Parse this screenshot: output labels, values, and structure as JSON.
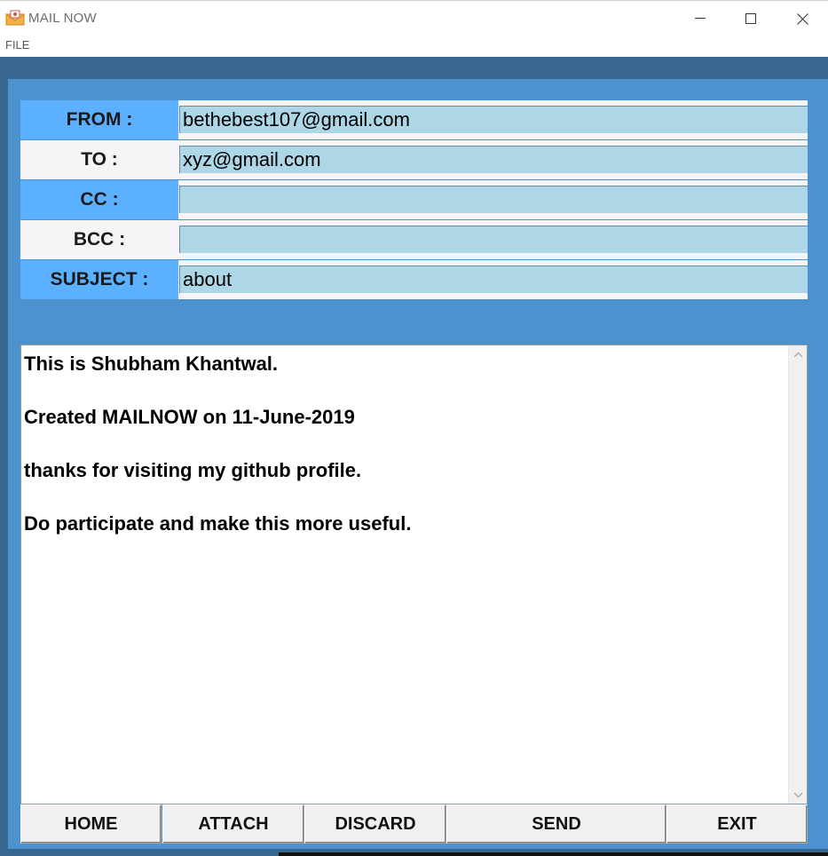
{
  "window": {
    "title": "MAIL NOW",
    "minimize_glyph": "—",
    "maximize_glyph": "☐",
    "close_glyph": "✕"
  },
  "menu": {
    "file_label": "FILE"
  },
  "fields": {
    "from": {
      "label": "FROM :",
      "value": "bethebest107@gmail.com"
    },
    "to": {
      "label": "TO :",
      "value": "xyz@gmail.com"
    },
    "cc": {
      "label": "CC :",
      "value": ""
    },
    "bcc": {
      "label": "BCC :",
      "value": ""
    },
    "subject": {
      "label": "SUBJECT :",
      "value": "about"
    }
  },
  "body": {
    "lines": [
      "This is Shubham Khantwal.",
      "Created MAILNOW on 11-June-2019",
      "thanks for visiting my github profile.",
      "Do participate and make this more useful."
    ]
  },
  "buttons": {
    "home": "HOME",
    "attach": "ATTACH",
    "discard": "DISCARD",
    "send": "SEND",
    "exit": "EXIT"
  },
  "icons": {
    "app": "mail-envelope-icon",
    "scroll_up": "chevron-up-icon",
    "scroll_down": "chevron-down-icon"
  },
  "colors": {
    "frame_dark": "#386890",
    "frame_light": "#4b92cf",
    "label_blue": "#5bb1ff",
    "input_bg": "#add6e6",
    "button_bg": "#f0f0f0"
  }
}
